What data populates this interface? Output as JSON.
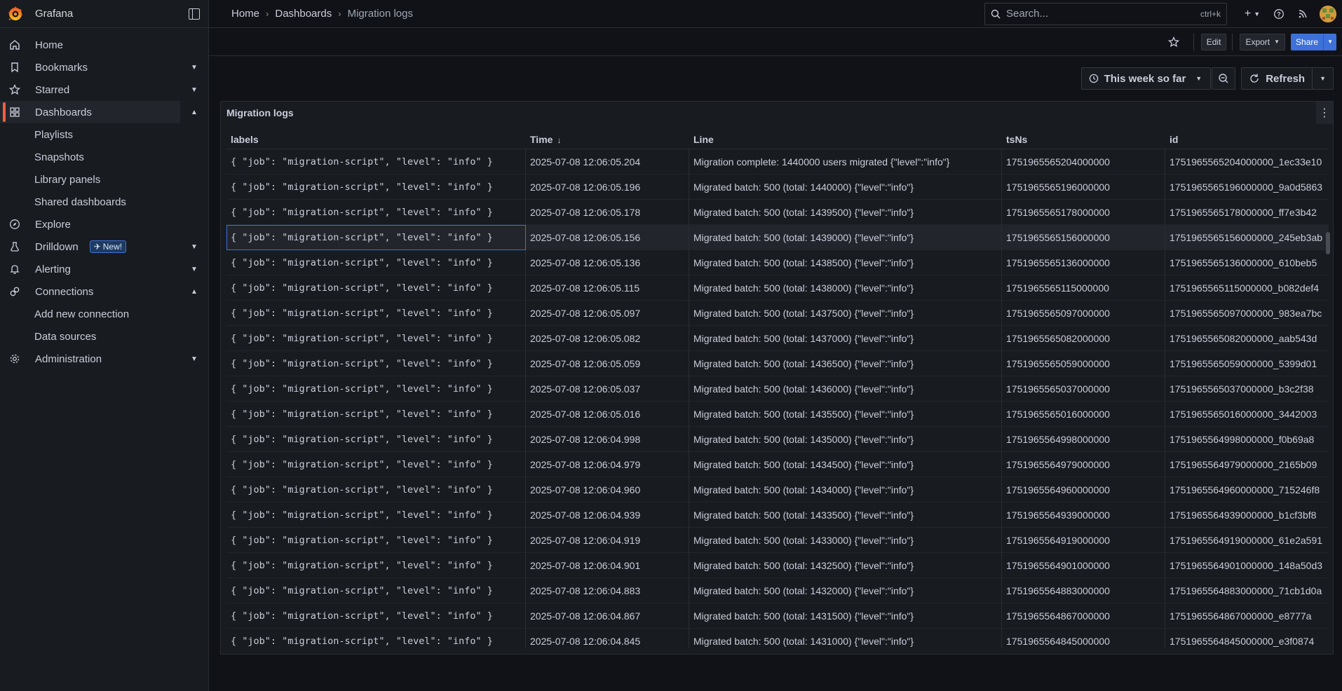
{
  "brand": {
    "name": "Grafana"
  },
  "nav": {
    "items": [
      {
        "label": "Home",
        "icon": "home-icon",
        "chevron": ""
      },
      {
        "label": "Bookmarks",
        "icon": "bookmark-icon",
        "chevron": "⌄"
      },
      {
        "label": "Starred",
        "icon": "star-icon",
        "chevron": "⌄"
      },
      {
        "label": "Dashboards",
        "icon": "apps-icon",
        "chevron": "⌃"
      }
    ],
    "dashboards_sub": [
      "Playlists",
      "Snapshots",
      "Library panels",
      "Shared dashboards"
    ],
    "items2": [
      {
        "label": "Explore",
        "icon": "compass-icon",
        "chevron": ""
      },
      {
        "label": "Drilldown",
        "icon": "drilldown-icon",
        "chevron": "⌄",
        "badge": "New!"
      },
      {
        "label": "Alerting",
        "icon": "bell-icon",
        "chevron": "⌄"
      },
      {
        "label": "Connections",
        "icon": "link-icon",
        "chevron": "⌃"
      }
    ],
    "connections_sub": [
      "Add new connection",
      "Data sources"
    ],
    "items3": [
      {
        "label": "Administration",
        "icon": "cog-icon",
        "chevron": "⌄"
      }
    ]
  },
  "breadcrumb": {
    "home": "Home",
    "dashboards": "Dashboards",
    "current": "Migration logs"
  },
  "search": {
    "placeholder": "Search...",
    "shortcut": "ctrl+k"
  },
  "toolbar": {
    "edit": "Edit",
    "export": "Export",
    "share": "Share"
  },
  "controls": {
    "time_range": "This week so far",
    "refresh": "Refresh"
  },
  "panel": {
    "title": "Migration logs",
    "columns": [
      "labels",
      "Time",
      "Line",
      "tsNs",
      "id"
    ],
    "sort_column": "Time",
    "rows": [
      {
        "labels": "{ \"job\": \"migration-script\", \"level\": \"info\" }",
        "time": "2025-07-08 12:06:05.204",
        "line": "Migration complete: 1440000 users migrated {\"level\":\"info\"}",
        "tsns": "1751965565204000000",
        "id": "1751965565204000000_1ec33e10"
      },
      {
        "labels": "{ \"job\": \"migration-script\", \"level\": \"info\" }",
        "time": "2025-07-08 12:06:05.196",
        "line": "Migrated batch: 500 (total: 1440000) {\"level\":\"info\"}",
        "tsns": "1751965565196000000",
        "id": "1751965565196000000_9a0d5863"
      },
      {
        "labels": "{ \"job\": \"migration-script\", \"level\": \"info\" }",
        "time": "2025-07-08 12:06:05.178",
        "line": "Migrated batch: 500 (total: 1439500) {\"level\":\"info\"}",
        "tsns": "1751965565178000000",
        "id": "1751965565178000000_ff7e3b42"
      },
      {
        "labels": "{ \"job\": \"migration-script\", \"level\": \"info\" }",
        "time": "2025-07-08 12:06:05.156",
        "line": "Migrated batch: 500 (total: 1439000) {\"level\":\"info\"}",
        "tsns": "1751965565156000000",
        "id": "1751965565156000000_245eb3ab"
      },
      {
        "labels": "{ \"job\": \"migration-script\", \"level\": \"info\" }",
        "time": "2025-07-08 12:06:05.136",
        "line": "Migrated batch: 500 (total: 1438500) {\"level\":\"info\"}",
        "tsns": "1751965565136000000",
        "id": "1751965565136000000_610beb5"
      },
      {
        "labels": "{ \"job\": \"migration-script\", \"level\": \"info\" }",
        "time": "2025-07-08 12:06:05.115",
        "line": "Migrated batch: 500 (total: 1438000) {\"level\":\"info\"}",
        "tsns": "1751965565115000000",
        "id": "1751965565115000000_b082def4"
      },
      {
        "labels": "{ \"job\": \"migration-script\", \"level\": \"info\" }",
        "time": "2025-07-08 12:06:05.097",
        "line": "Migrated batch: 500 (total: 1437500) {\"level\":\"info\"}",
        "tsns": "1751965565097000000",
        "id": "1751965565097000000_983ea7bc"
      },
      {
        "labels": "{ \"job\": \"migration-script\", \"level\": \"info\" }",
        "time": "2025-07-08 12:06:05.082",
        "line": "Migrated batch: 500 (total: 1437000) {\"level\":\"info\"}",
        "tsns": "1751965565082000000",
        "id": "1751965565082000000_aab543d"
      },
      {
        "labels": "{ \"job\": \"migration-script\", \"level\": \"info\" }",
        "time": "2025-07-08 12:06:05.059",
        "line": "Migrated batch: 500 (total: 1436500) {\"level\":\"info\"}",
        "tsns": "1751965565059000000",
        "id": "1751965565059000000_5399d01"
      },
      {
        "labels": "{ \"job\": \"migration-script\", \"level\": \"info\" }",
        "time": "2025-07-08 12:06:05.037",
        "line": "Migrated batch: 500 (total: 1436000) {\"level\":\"info\"}",
        "tsns": "1751965565037000000",
        "id": "1751965565037000000_b3c2f38"
      },
      {
        "labels": "{ \"job\": \"migration-script\", \"level\": \"info\" }",
        "time": "2025-07-08 12:06:05.016",
        "line": "Migrated batch: 500 (total: 1435500) {\"level\":\"info\"}",
        "tsns": "1751965565016000000",
        "id": "1751965565016000000_3442003"
      },
      {
        "labels": "{ \"job\": \"migration-script\", \"level\": \"info\" }",
        "time": "2025-07-08 12:06:04.998",
        "line": "Migrated batch: 500 (total: 1435000) {\"level\":\"info\"}",
        "tsns": "1751965564998000000",
        "id": "1751965564998000000_f0b69a8"
      },
      {
        "labels": "{ \"job\": \"migration-script\", \"level\": \"info\" }",
        "time": "2025-07-08 12:06:04.979",
        "line": "Migrated batch: 500 (total: 1434500) {\"level\":\"info\"}",
        "tsns": "1751965564979000000",
        "id": "1751965564979000000_2165b09"
      },
      {
        "labels": "{ \"job\": \"migration-script\", \"level\": \"info\" }",
        "time": "2025-07-08 12:06:04.960",
        "line": "Migrated batch: 500 (total: 1434000) {\"level\":\"info\"}",
        "tsns": "1751965564960000000",
        "id": "1751965564960000000_715246f8"
      },
      {
        "labels": "{ \"job\": \"migration-script\", \"level\": \"info\" }",
        "time": "2025-07-08 12:06:04.939",
        "line": "Migrated batch: 500 (total: 1433500) {\"level\":\"info\"}",
        "tsns": "1751965564939000000",
        "id": "1751965564939000000_b1cf3bf8"
      },
      {
        "labels": "{ \"job\": \"migration-script\", \"level\": \"info\" }",
        "time": "2025-07-08 12:06:04.919",
        "line": "Migrated batch: 500 (total: 1433000) {\"level\":\"info\"}",
        "tsns": "1751965564919000000",
        "id": "1751965564919000000_61e2a591"
      },
      {
        "labels": "{ \"job\": \"migration-script\", \"level\": \"info\" }",
        "time": "2025-07-08 12:06:04.901",
        "line": "Migrated batch: 500 (total: 1432500) {\"level\":\"info\"}",
        "tsns": "1751965564901000000",
        "id": "1751965564901000000_148a50d3"
      },
      {
        "labels": "{ \"job\": \"migration-script\", \"level\": \"info\" }",
        "time": "2025-07-08 12:06:04.883",
        "line": "Migrated batch: 500 (total: 1432000) {\"level\":\"info\"}",
        "tsns": "1751965564883000000",
        "id": "1751965564883000000_71cb1d0a"
      },
      {
        "labels": "{ \"job\": \"migration-script\", \"level\": \"info\" }",
        "time": "2025-07-08 12:06:04.867",
        "line": "Migrated batch: 500 (total: 1431500) {\"level\":\"info\"}",
        "tsns": "1751965564867000000",
        "id": "1751965564867000000_e8777a"
      },
      {
        "labels": "{ \"job\": \"migration-script\", \"level\": \"info\" }",
        "time": "2025-07-08 12:06:04.845",
        "line": "Migrated batch: 500 (total: 1431000) {\"level\":\"info\"}",
        "tsns": "1751965564845000000",
        "id": "1751965564845000000_e3f0874"
      }
    ]
  },
  "colors": {
    "accent": "#3d71d9",
    "active_marker": "#f55f3e",
    "background": "#111217",
    "panel": "#181b1f"
  }
}
